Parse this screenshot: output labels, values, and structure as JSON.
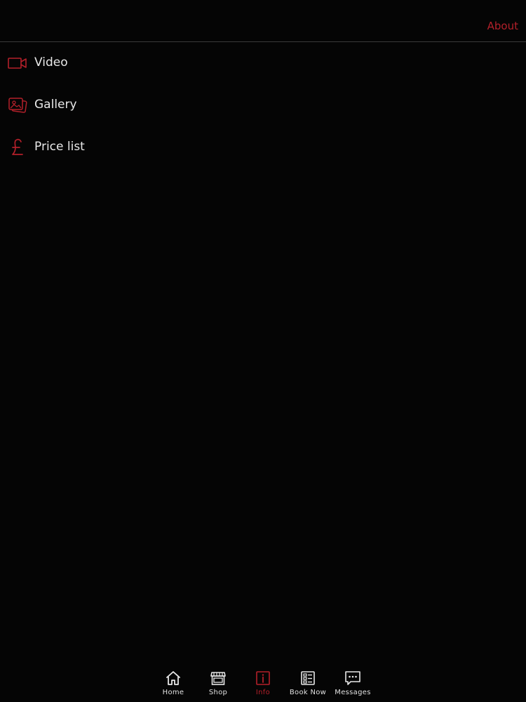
{
  "colors": {
    "accent": "#b3202a",
    "background": "#050505",
    "text": "#e8e8e8",
    "divider": "#3a3a3a"
  },
  "header": {
    "about_label": "About"
  },
  "menu": {
    "items": [
      {
        "label": "Video",
        "icon": "video-camera-icon"
      },
      {
        "label": "Gallery",
        "icon": "gallery-icon"
      },
      {
        "label": "Price list",
        "icon": "pound-sign-icon"
      }
    ]
  },
  "tabbar": {
    "tabs": [
      {
        "label": "Home",
        "icon": "home-icon",
        "active": false
      },
      {
        "label": "Shop",
        "icon": "shop-icon",
        "active": false
      },
      {
        "label": "Info",
        "icon": "info-icon",
        "active": true
      },
      {
        "label": "Book Now",
        "icon": "book-now-icon",
        "active": false
      },
      {
        "label": "Messages",
        "icon": "messages-icon",
        "active": false
      }
    ]
  }
}
